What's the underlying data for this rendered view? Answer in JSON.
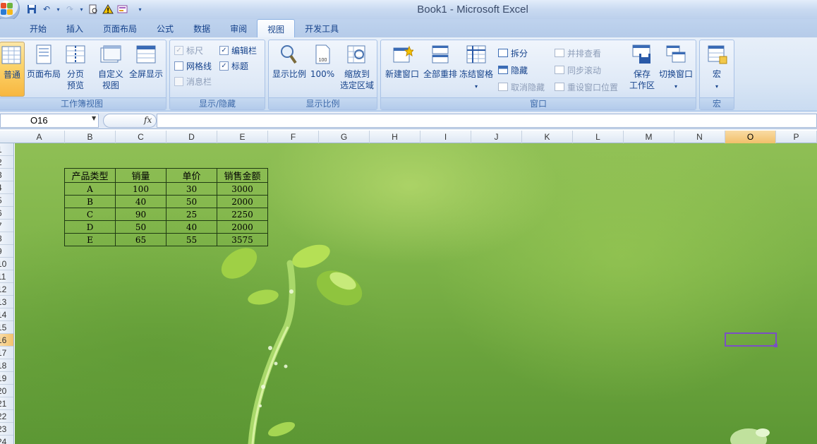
{
  "window": {
    "title": "Book1 - Microsoft Excel"
  },
  "tabs": [
    {
      "label": "开始"
    },
    {
      "label": "插入"
    },
    {
      "label": "页面布局"
    },
    {
      "label": "公式"
    },
    {
      "label": "数据"
    },
    {
      "label": "审阅"
    },
    {
      "label": "视图"
    },
    {
      "label": "开发工具"
    }
  ],
  "active_tab": "视图",
  "ribbon": {
    "workbook_views": {
      "label": "工作簿视图",
      "normal": "普通",
      "page_layout": "页面布局",
      "page_break_1": "分页",
      "page_break_2": "预览",
      "custom_1": "自定义",
      "custom_2": "视图",
      "full_screen": "全屏显示"
    },
    "show_hide": {
      "label": "显示/隐藏",
      "ruler": "标尺",
      "gridlines": "网格线",
      "message_bar": "消息栏",
      "formula_bar": "编辑栏",
      "headings": "标题"
    },
    "zoom": {
      "label": "显示比例",
      "zoom": "显示比例",
      "hundred": "100%",
      "hundred_icon": "100",
      "to_sel_1": "缩放到",
      "to_sel_2": "选定区域"
    },
    "window": {
      "label": "窗口",
      "new_window": "新建窗口",
      "arrange_all": "全部重排",
      "freeze": "冻结窗格",
      "split": "拆分",
      "hide": "隐藏",
      "unhide": "取消隐藏",
      "side_by_side": "并排查看",
      "sync_scroll": "同步滚动",
      "reset_pos": "重设窗口位置",
      "save_ws_1": "保存",
      "save_ws_2": "工作区",
      "switch": "切换窗口"
    },
    "macros": {
      "label": "宏",
      "macros": "宏"
    }
  },
  "formula_bar": {
    "name_box": "O16",
    "fx": "fx",
    "value": ""
  },
  "columns": [
    "A",
    "B",
    "C",
    "D",
    "E",
    "F",
    "G",
    "H",
    "I",
    "J",
    "K",
    "L",
    "M",
    "N",
    "O",
    "P"
  ],
  "selected_column": "O",
  "rows": [
    "1",
    "2",
    "3",
    "4",
    "5",
    "6",
    "7",
    "8",
    "9",
    "10",
    "11",
    "12",
    "13",
    "14",
    "15",
    "16",
    "17",
    "18",
    "19",
    "20",
    "21",
    "22",
    "23",
    "24"
  ],
  "selected_row": "16",
  "table": {
    "headers": [
      "产品类型",
      "销量",
      "单价",
      "销售金额"
    ],
    "rows": [
      [
        "A",
        "100",
        "30",
        "3000"
      ],
      [
        "B",
        "40",
        "50",
        "2000"
      ],
      [
        "C",
        "90",
        "25",
        "2250"
      ],
      [
        "D",
        "50",
        "40",
        "2000"
      ],
      [
        "E",
        "65",
        "55",
        "3575"
      ]
    ]
  },
  "colors": {
    "accent": "#15428b",
    "selection": "#7b4fc4",
    "active_button": "#fbd36a"
  }
}
